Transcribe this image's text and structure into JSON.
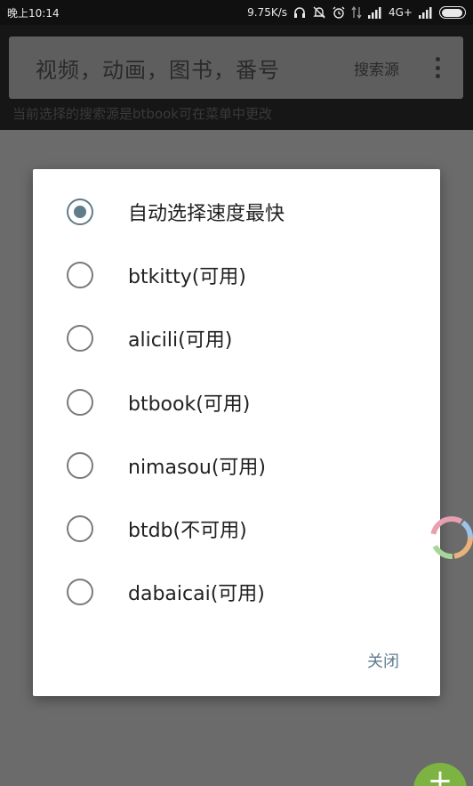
{
  "status_bar": {
    "time": "晚上10:14",
    "net_speed": "9.75K/s",
    "network_type": "4G+",
    "battery_level": 0.95
  },
  "header": {
    "search_placeholder": "视频，动画，图书，番号",
    "search_source_label": "搜索源",
    "source_hint": "当前选择的搜索源是btbook可在菜单中更改"
  },
  "dialog": {
    "options": [
      {
        "label": "自动选择速度最快",
        "checked": true
      },
      {
        "label": "btkitty(可用)",
        "checked": false
      },
      {
        "label": "alicili(可用)",
        "checked": false
      },
      {
        "label": "btbook(可用)",
        "checked": false
      },
      {
        "label": "nimasou(可用)",
        "checked": false
      },
      {
        "label": "btdb(不可用)",
        "checked": false
      },
      {
        "label": "dabaicai(可用)",
        "checked": false
      }
    ],
    "close_label": "关闭"
  },
  "fab": {
    "icon": "plus-icon",
    "label": "+"
  },
  "colors": {
    "accent": "#607d8b",
    "close_text": "#5f7d8e",
    "fab": "#7cb342",
    "scrim": "#6b6b6b"
  }
}
